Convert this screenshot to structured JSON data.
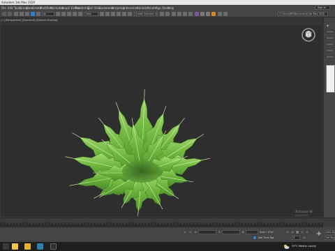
{
  "app": {
    "title": "Autodesk 3ds Max 2020"
  },
  "menu": {
    "items": [
      "File",
      "Edit",
      "Tools",
      "Group",
      "Views",
      "Create",
      "Modifiers",
      "Animation",
      "Graph Editors",
      "Rendering",
      "Civil View",
      "Customize",
      "Scripting",
      "Interactive",
      "Content",
      "Arnold",
      "App Store",
      "Help"
    ],
    "sign_in": "Sign In"
  },
  "toolbar": {
    "filter_label": "All",
    "view_label": "View",
    "selection_set_label": "Create Selection Se",
    "project_path": "C:\\Users\\WH\\Documents\\3ds Max 2020"
  },
  "viewport": {
    "label": "[+] [Perspective] [Standard] [Default Shading]",
    "watermark_line1": "Activate W",
    "watermark_line2": "Go to Settin"
  },
  "status": {
    "x_label": "X:",
    "x_value": "",
    "y_label": "Y:",
    "y_value": "",
    "z_label": "Z:",
    "z_value": "",
    "grid_label": "Grid = 0'10\"",
    "add_time_tag": "Add Time Tag",
    "frame_value": "0",
    "auto_key": "Auto Key",
    "set_key": "Set Key"
  },
  "taskbar": {
    "weather_temp": "32°C",
    "weather_text": "Mostly cloudy"
  },
  "colors": {
    "fern_dark": "#4a8a2a",
    "fern_mid": "#6cb43c",
    "fern_light": "#a6dc72",
    "accent_blue": "#2a82d0"
  }
}
